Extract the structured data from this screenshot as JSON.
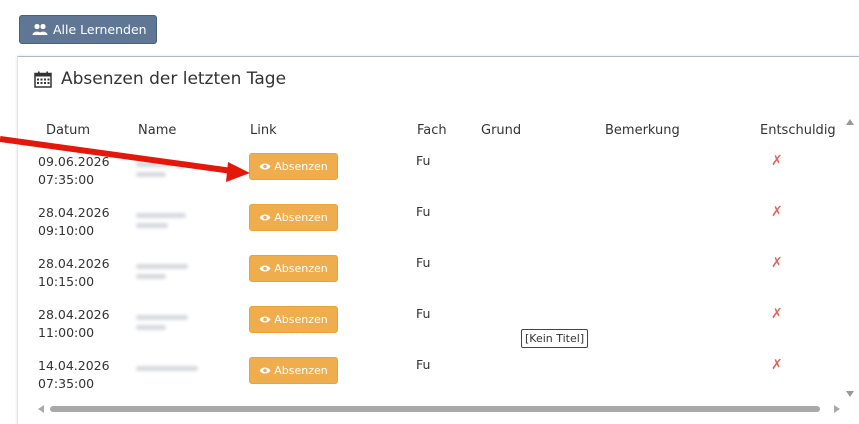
{
  "toolbar": {
    "all_learners_label": "Alle Lernenden"
  },
  "panel": {
    "title": "Absenzen der letzten Tage"
  },
  "table": {
    "columns": [
      "Datum",
      "Name",
      "Link",
      "Fach",
      "Grund",
      "Bemerkung",
      "Entschuldig"
    ],
    "rows": [
      {
        "date": "09.06.2026",
        "time": "07:35:00",
        "link_label": "Absenzen",
        "fach": "Fu",
        "excused": "✗"
      },
      {
        "date": "28.04.2026",
        "time": "09:10:00",
        "link_label": "Absenzen",
        "fach": "Fu",
        "excused": "✗"
      },
      {
        "date": "28.04.2026",
        "time": "10:15:00",
        "link_label": "Absenzen",
        "fach": "Fu",
        "excused": "✗"
      },
      {
        "date": "28.04.2026",
        "time": "11:00:00",
        "link_label": "Absenzen",
        "fach": "Fu",
        "excused": "✗"
      },
      {
        "date": "14.04.2026",
        "time": "07:35:00",
        "link_label": "Absenzen",
        "fach": "Fu",
        "excused": "✗"
      }
    ]
  },
  "tooltip": {
    "text": "[Kein Titel]"
  },
  "colors": {
    "button_primary": "#5f7694",
    "button_warning": "#f0ad4e",
    "cross": "#e0665c",
    "arrow": "#e3170a"
  }
}
